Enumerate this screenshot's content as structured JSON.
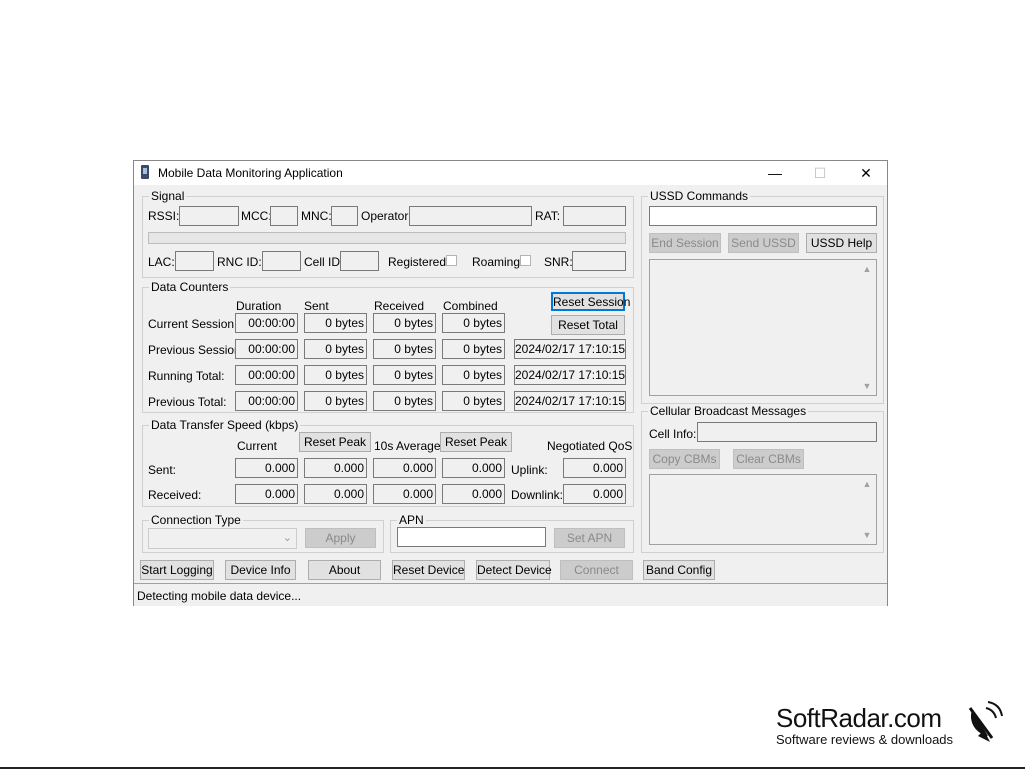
{
  "window": {
    "title": "Mobile Data Monitoring Application",
    "controls": {
      "minimize": "—",
      "maximize": "☐",
      "close": "✕"
    }
  },
  "signal": {
    "label": "Signal",
    "rssi": "RSSI:",
    "mcc": "MCC:",
    "mnc": "MNC:",
    "operator": "Operator:",
    "rat": "RAT:",
    "lac": "LAC:",
    "rnc_id": "RNC ID:",
    "cell_id": "Cell ID:",
    "registered": "Registered:",
    "roaming": "Roaming:",
    "snr": "SNR:"
  },
  "counters": {
    "label": "Data Counters",
    "headers": {
      "duration": "Duration",
      "sent": "Sent",
      "received": "Received",
      "combined": "Combined"
    },
    "reset_session": "Reset Session",
    "reset_total": "Reset Total",
    "rows": [
      {
        "label": "Current Session:",
        "duration": "00:00:00",
        "sent": "0 bytes",
        "received": "0 bytes",
        "combined": "0 bytes",
        "time": ""
      },
      {
        "label": "Previous Session:",
        "duration": "00:00:00",
        "sent": "0 bytes",
        "received": "0 bytes",
        "combined": "0 bytes",
        "time": "2024/02/17 17:10:15"
      },
      {
        "label": "Running Total:",
        "duration": "00:00:00",
        "sent": "0 bytes",
        "received": "0 bytes",
        "combined": "0 bytes",
        "time": "2024/02/17 17:10:15"
      },
      {
        "label": "Previous Total:",
        "duration": "00:00:00",
        "sent": "0 bytes",
        "received": "0 bytes",
        "combined": "0 bytes",
        "time": "2024/02/17 17:10:15"
      }
    ]
  },
  "speed": {
    "label": "Data Transfer Speed (kbps)",
    "current": "Current",
    "reset_peak": "Reset Peak",
    "avg": "10s Average",
    "qos": "Negotiated QoS",
    "sent_label": "Sent:",
    "received_label": "Received:",
    "uplink": "Uplink:",
    "downlink": "Downlink:",
    "sent": [
      "0.000",
      "0.000",
      "0.000",
      "0.000"
    ],
    "received": [
      "0.000",
      "0.000",
      "0.000",
      "0.000"
    ],
    "uplink_value": "0.000",
    "downlink_value": "0.000"
  },
  "connection": {
    "label": "Connection Type",
    "apply": "Apply"
  },
  "apn": {
    "label": "APN",
    "set": "Set APN",
    "value": ""
  },
  "ussd": {
    "label": "USSD Commands",
    "end": "End Session",
    "send": "Send USSD",
    "help": "USSD Help"
  },
  "cbm": {
    "label": "Cellular Broadcast Messages",
    "cell_info": "Cell Info:",
    "copy": "Copy CBMs",
    "clear": "Clear CBMs"
  },
  "buttons": {
    "start_logging": "Start Logging",
    "device_info": "Device Info",
    "about": "About",
    "reset_device": "Reset Device",
    "detect_device": "Detect Device",
    "connect": "Connect",
    "band_config": "Band Config"
  },
  "status": "Detecting mobile data device...",
  "watermark": {
    "main": "SoftRadar.com",
    "sub": "Software reviews & downloads"
  }
}
